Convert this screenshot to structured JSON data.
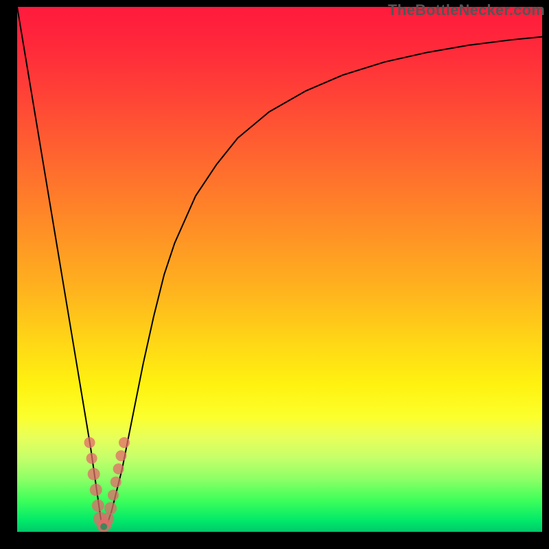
{
  "watermark": "TheBottleNecker.com",
  "chart_data": {
    "type": "line",
    "title": "",
    "xlabel": "",
    "ylabel": "",
    "xlim": [
      0,
      100
    ],
    "ylim": [
      0,
      100
    ],
    "series": [
      {
        "name": "bottleneck-curve",
        "x": [
          0,
          2,
          4,
          6,
          8,
          10,
          12,
          14,
          15,
          16,
          17,
          18,
          20,
          22,
          24,
          26,
          28,
          30,
          34,
          38,
          42,
          48,
          55,
          62,
          70,
          78,
          86,
          94,
          100
        ],
        "values": [
          100,
          88,
          76,
          64,
          52,
          40,
          28,
          16,
          9,
          2,
          1,
          4,
          12,
          22,
          32,
          41,
          49,
          55,
          64,
          70,
          75,
          80,
          84,
          87,
          89.5,
          91.3,
          92.7,
          93.7,
          94.3
        ]
      }
    ],
    "markers": {
      "name": "cluster-points",
      "points": [
        {
          "x": 13.8,
          "y": 17,
          "r": 8
        },
        {
          "x": 14.2,
          "y": 14,
          "r": 8
        },
        {
          "x": 14.6,
          "y": 11,
          "r": 9
        },
        {
          "x": 15.0,
          "y": 8,
          "r": 9
        },
        {
          "x": 15.4,
          "y": 5,
          "r": 9
        },
        {
          "x": 15.8,
          "y": 2.5,
          "r": 10
        },
        {
          "x": 16.3,
          "y": 1.2,
          "r": 9
        },
        {
          "x": 16.8,
          "y": 1.3,
          "r": 9
        },
        {
          "x": 17.3,
          "y": 2.5,
          "r": 9
        },
        {
          "x": 17.8,
          "y": 4.5,
          "r": 9
        },
        {
          "x": 18.3,
          "y": 7,
          "r": 8
        },
        {
          "x": 18.8,
          "y": 9.5,
          "r": 8
        },
        {
          "x": 19.3,
          "y": 12,
          "r": 8
        },
        {
          "x": 19.8,
          "y": 14.5,
          "r": 8
        },
        {
          "x": 20.4,
          "y": 17,
          "r": 8
        }
      ],
      "min_point": {
        "x": 16.5,
        "y": 1.0,
        "r": 5
      }
    },
    "colors": {
      "curve": "#000000",
      "marker": "#e26a6a",
      "min_point": "#2d8a5a"
    }
  }
}
